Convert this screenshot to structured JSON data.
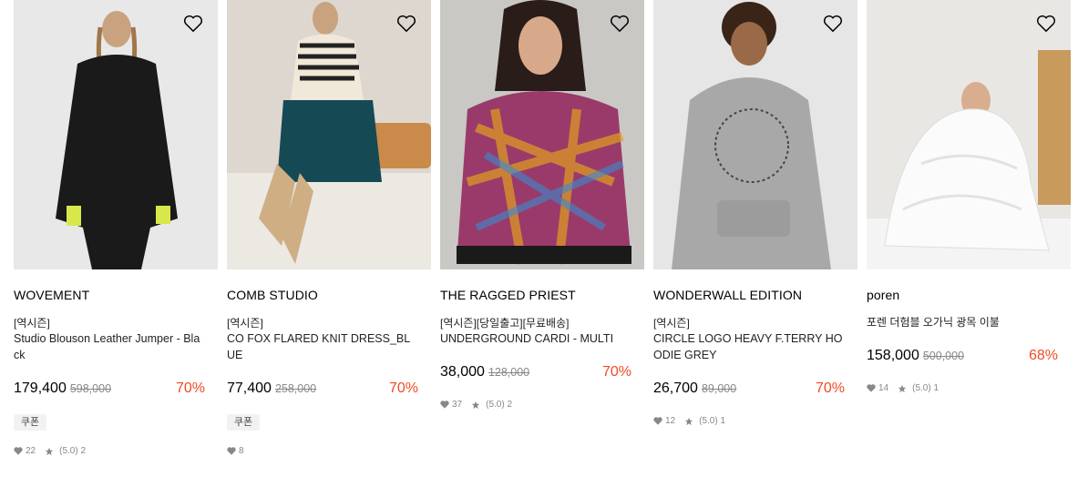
{
  "products": [
    {
      "brand": "WOVEMENT",
      "tag": "[역시즌]",
      "name": "Studio Blouson Leather Jumper - Black",
      "price": "179,400",
      "original_price": "598,000",
      "discount": "70%",
      "coupon": "쿠폰",
      "likes": "22",
      "rating": "(5.0) 2",
      "image": {
        "bg": "#e8e8e8",
        "subject": "woman-black-leather-dress"
      }
    },
    {
      "brand": "COMB STUDIO",
      "tag": "[역시즌]",
      "name": "CO FOX FLARED KNIT DRESS_BLUE",
      "price": "77,400",
      "original_price": "258,000",
      "discount": "70%",
      "coupon": "쿠폰",
      "likes": "8",
      "rating": "",
      "image": {
        "bg": "#ddd7d0",
        "subject": "woman-teal-knit-dress-bench"
      }
    },
    {
      "brand": "THE RAGGED PRIEST",
      "tag": "[역시즌][당일출고][무료배송]",
      "name": "UNDERGROUND CARDI - MULTI",
      "price": "38,000",
      "original_price": "128,000",
      "discount": "70%",
      "coupon": "",
      "likes": "37",
      "rating": "(5.0) 2",
      "image": {
        "bg": "#c9c8c4",
        "subject": "woman-multicolor-cardigan"
      }
    },
    {
      "brand": "WONDERWALL EDITION",
      "tag": "[역시즌]",
      "name": "CIRCLE LOGO HEAVY F.TERRY HOODIE GREY",
      "price": "26,700",
      "original_price": "89,000",
      "discount": "70%",
      "coupon": "",
      "likes": "12",
      "rating": "(5.0) 1",
      "image": {
        "bg": "#e6e6e6",
        "subject": "man-grey-hoodie"
      }
    },
    {
      "brand": "poren",
      "tag": "",
      "name": "포렌 더험블 오가닉 광목 이불",
      "price": "158,000",
      "original_price": "500,000",
      "discount": "68%",
      "coupon": "",
      "likes": "14",
      "rating": "(5.0) 1",
      "image": {
        "bg": "#e9e7e4",
        "subject": "woman-white-duvet"
      }
    }
  ],
  "icons": {
    "wishlist": "heart-outline-icon",
    "likes": "heart-icon",
    "rating": "star-icon"
  },
  "colors": {
    "discount": "#f04b25",
    "muted": "#888888",
    "coupon_bg": "#f2f2f2"
  }
}
